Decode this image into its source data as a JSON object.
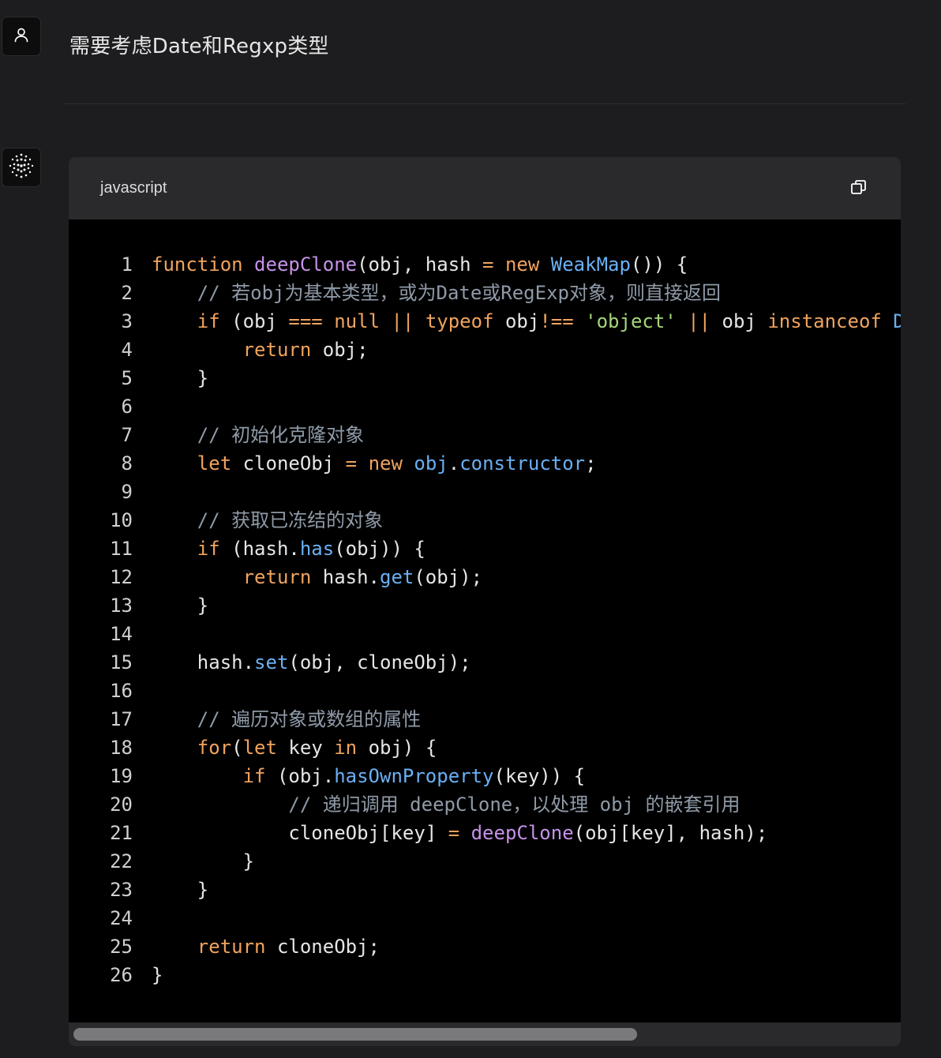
{
  "user_message": {
    "text": "需要考虑Date和Regxp类型",
    "avatar_icon": "user-icon"
  },
  "assistant": {
    "avatar_icon": "dotted-sphere-icon"
  },
  "code_block": {
    "language": "javascript",
    "copy_icon": "copy-icon",
    "lines": [
      [
        [
          "kw",
          "function"
        ],
        [
          "pl",
          " "
        ],
        [
          "fn",
          "deepClone"
        ],
        [
          "pl",
          "(obj, hash "
        ],
        [
          "op",
          "="
        ],
        [
          "pl",
          " "
        ],
        [
          "kw",
          "new"
        ],
        [
          "pl",
          " "
        ],
        [
          "cls",
          "WeakMap"
        ],
        [
          "pl",
          "()) {"
        ]
      ],
      [
        [
          "pl",
          "    "
        ],
        [
          "cm",
          "// 若obj为基本类型，或为Date或RegExp对象，则直接返回"
        ]
      ],
      [
        [
          "pl",
          "    "
        ],
        [
          "kw",
          "if"
        ],
        [
          "pl",
          " (obj "
        ],
        [
          "op",
          "==="
        ],
        [
          "pl",
          " "
        ],
        [
          "kw",
          "null"
        ],
        [
          "pl",
          " "
        ],
        [
          "op",
          "||"
        ],
        [
          "pl",
          " "
        ],
        [
          "kw",
          "typeof"
        ],
        [
          "pl",
          " obj"
        ],
        [
          "op",
          "!=="
        ],
        [
          "pl",
          " "
        ],
        [
          "str",
          "'object'"
        ],
        [
          "pl",
          " "
        ],
        [
          "op",
          "||"
        ],
        [
          "pl",
          " obj "
        ],
        [
          "kw",
          "instanceof"
        ],
        [
          "pl",
          " "
        ],
        [
          "cls",
          "D"
        ]
      ],
      [
        [
          "pl",
          "        "
        ],
        [
          "kw",
          "return"
        ],
        [
          "pl",
          " obj;"
        ]
      ],
      [
        [
          "pl",
          "    }"
        ]
      ],
      [],
      [
        [
          "pl",
          "    "
        ],
        [
          "cm",
          "// 初始化克隆对象"
        ]
      ],
      [
        [
          "pl",
          "    "
        ],
        [
          "kw",
          "let"
        ],
        [
          "pl",
          " cloneObj "
        ],
        [
          "op",
          "="
        ],
        [
          "pl",
          " "
        ],
        [
          "kw",
          "new"
        ],
        [
          "pl",
          " "
        ],
        [
          "cls",
          "obj"
        ],
        [
          "pl",
          "."
        ],
        [
          "cls",
          "constructor"
        ],
        [
          "pl",
          ";"
        ]
      ],
      [],
      [
        [
          "pl",
          "    "
        ],
        [
          "cm",
          "// 获取已冻结的对象"
        ]
      ],
      [
        [
          "pl",
          "    "
        ],
        [
          "kw",
          "if"
        ],
        [
          "pl",
          " (hash."
        ],
        [
          "cls",
          "has"
        ],
        [
          "pl",
          "(obj)) {"
        ]
      ],
      [
        [
          "pl",
          "        "
        ],
        [
          "kw",
          "return"
        ],
        [
          "pl",
          " hash."
        ],
        [
          "cls",
          "get"
        ],
        [
          "pl",
          "(obj);"
        ]
      ],
      [
        [
          "pl",
          "    }"
        ]
      ],
      [],
      [
        [
          "pl",
          "    hash."
        ],
        [
          "cls",
          "set"
        ],
        [
          "pl",
          "(obj, cloneObj);"
        ]
      ],
      [],
      [
        [
          "pl",
          "    "
        ],
        [
          "cm",
          "// 遍历对象或数组的属性"
        ]
      ],
      [
        [
          "pl",
          "    "
        ],
        [
          "kw",
          "for"
        ],
        [
          "pl",
          "("
        ],
        [
          "kw",
          "let"
        ],
        [
          "pl",
          " key "
        ],
        [
          "kw",
          "in"
        ],
        [
          "pl",
          " obj) {"
        ]
      ],
      [
        [
          "pl",
          "        "
        ],
        [
          "kw",
          "if"
        ],
        [
          "pl",
          " (obj."
        ],
        [
          "cls",
          "hasOwnProperty"
        ],
        [
          "pl",
          "(key)) {"
        ]
      ],
      [
        [
          "pl",
          "            "
        ],
        [
          "cm",
          "// 递归调用 deepClone，以处理 obj 的嵌套引用"
        ]
      ],
      [
        [
          "pl",
          "            cloneObj[key] "
        ],
        [
          "op",
          "="
        ],
        [
          "pl",
          " "
        ],
        [
          "fn",
          "deepClone"
        ],
        [
          "pl",
          "(obj[key], hash);"
        ]
      ],
      [
        [
          "pl",
          "        }"
        ]
      ],
      [
        [
          "pl",
          "    }"
        ]
      ],
      [],
      [
        [
          "pl",
          "    "
        ],
        [
          "kw",
          "return"
        ],
        [
          "pl",
          " cloneObj;"
        ]
      ],
      [
        [
          "pl",
          "}"
        ]
      ]
    ]
  }
}
